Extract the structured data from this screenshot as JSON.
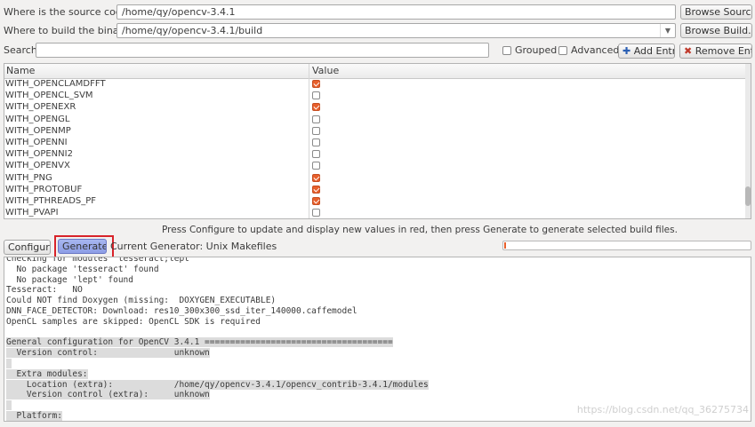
{
  "source": {
    "label": "Where is the source code:",
    "value": "/home/qy/opencv-3.4.1",
    "browse_label": "Browse Source..."
  },
  "build": {
    "label": "Where to build the binaries:",
    "value": "/home/qy/opencv-3.4.1/build",
    "browse_label": "Browse Build..."
  },
  "search": {
    "label": "Search:",
    "value": ""
  },
  "options": {
    "grouped": "Grouped",
    "advanced": "Advanced",
    "add_entry": "Add Entry",
    "remove_entry": "Remove Entry"
  },
  "table": {
    "columns": [
      "Name",
      "Value"
    ],
    "rows": [
      {
        "name": "WITH_OPENCLAMDFFT",
        "checked": true
      },
      {
        "name": "WITH_OPENCL_SVM",
        "checked": false
      },
      {
        "name": "WITH_OPENEXR",
        "checked": true
      },
      {
        "name": "WITH_OPENGL",
        "checked": false
      },
      {
        "name": "WITH_OPENMP",
        "checked": false
      },
      {
        "name": "WITH_OPENNI",
        "checked": false
      },
      {
        "name": "WITH_OPENNI2",
        "checked": false
      },
      {
        "name": "WITH_OPENVX",
        "checked": false
      },
      {
        "name": "WITH_PNG",
        "checked": true
      },
      {
        "name": "WITH_PROTOBUF",
        "checked": true
      },
      {
        "name": "WITH_PTHREADS_PF",
        "checked": true
      },
      {
        "name": "WITH_PVAPI",
        "checked": false
      }
    ]
  },
  "status_message": "Press Configure to update and display new values in red, then press Generate to generate selected build files.",
  "actions": {
    "configure": "Configure",
    "generate": "Generate",
    "current_generator": "Current Generator: Unix Makefiles"
  },
  "progress": 0.0,
  "accent_color": "#e8602c",
  "highlight_color": "#d8232a",
  "output_lines": [
    {
      "text": "Checking for modules 'tesseract;lept'",
      "hl": false
    },
    {
      "text": "  No package 'tesseract' found",
      "hl": false
    },
    {
      "text": "  No package 'lept' found",
      "hl": false
    },
    {
      "text": "Tesseract:   NO",
      "hl": false
    },
    {
      "text": "Could NOT find Doxygen (missing:  DOXYGEN_EXECUTABLE)",
      "hl": false
    },
    {
      "text": "DNN_FACE_DETECTOR: Download: res10_300x300_ssd_iter_140000.caffemodel",
      "hl": false
    },
    {
      "text": "OpenCL samples are skipped: OpenCL SDK is required",
      "hl": false
    },
    {
      "text": "",
      "hl": false
    },
    {
      "text": "General configuration for OpenCV 3.4.1 =====================================",
      "hl": true
    },
    {
      "text": "  Version control:               unknown",
      "hl": true
    },
    {
      "text": " ",
      "hl": true
    },
    {
      "text": "  Extra modules:",
      "hl": true
    },
    {
      "text": "    Location (extra):            /home/qy/opencv-3.4.1/opencv_contrib-3.4.1/modules",
      "hl": true
    },
    {
      "text": "    Version control (extra):     unknown",
      "hl": true
    },
    {
      "text": " ",
      "hl": true
    },
    {
      "text": "  Platform:",
      "hl": true
    }
  ],
  "watermark": "https://blog.csdn.net/qq_36275734"
}
